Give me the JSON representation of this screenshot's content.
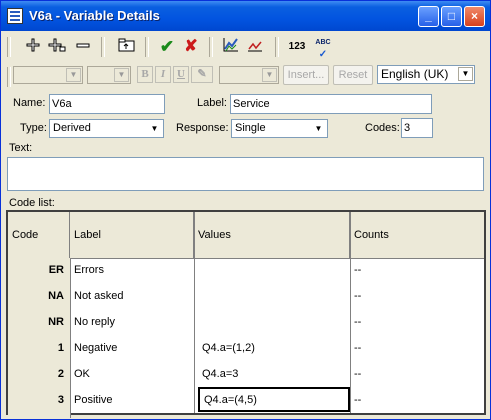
{
  "window": {
    "title": "V6a - Variable Details"
  },
  "titlebar_buttons": {
    "minimize": "_",
    "maximize": "□",
    "close": "×"
  },
  "toolbar": {
    "add_icon": "plus-icon",
    "insert_icon": "plus-insert-icon",
    "remove_icon": "minus-icon",
    "folder_icon": "folder-up-icon",
    "ok_icon": "check-icon",
    "cancel_icon": "cross-icon",
    "chart_icon": "chart-icon",
    "graph_icon": "graph-icon",
    "numbering_label": "123",
    "spellcheck_label": "ABC"
  },
  "format_bar": {
    "bold": "B",
    "italic": "I",
    "underline": "U",
    "insert_label": "Insert...",
    "reset_label": "Reset",
    "language": "English (UK)"
  },
  "form": {
    "name_label": "Name:",
    "name_value": "V6a",
    "label_label": "Label:",
    "label_value": "Service",
    "type_label": "Type:",
    "type_value": "Derived",
    "response_label": "Response:",
    "response_value": "Single",
    "codes_label": "Codes:",
    "codes_value": "3",
    "text_label": "Text:",
    "text_value": "",
    "code_list_label": "Code list:"
  },
  "code_table": {
    "columns": [
      "Code",
      "Label",
      "Values",
      "Counts"
    ],
    "rows": [
      {
        "code": "ER",
        "label": "Errors",
        "values": "",
        "counts": "--"
      },
      {
        "code": "NA",
        "label": "Not asked",
        "values": "",
        "counts": "--"
      },
      {
        "code": "NR",
        "label": "No reply",
        "values": "",
        "counts": "--"
      },
      {
        "code": "1",
        "label": "Negative",
        "values": "Q4.a=(1,2)",
        "counts": "--"
      },
      {
        "code": "2",
        "label": "OK",
        "values": "Q4.a=3",
        "counts": "--"
      },
      {
        "code": "3",
        "label": "Positive",
        "values": "Q4.a=(4,5)",
        "counts": "--"
      }
    ]
  },
  "colors": {
    "title_bar": "#0254e0",
    "window_bg": "#ece9d8",
    "ok_green": "#1a8a1a",
    "cancel_red": "#cc1a1a"
  }
}
